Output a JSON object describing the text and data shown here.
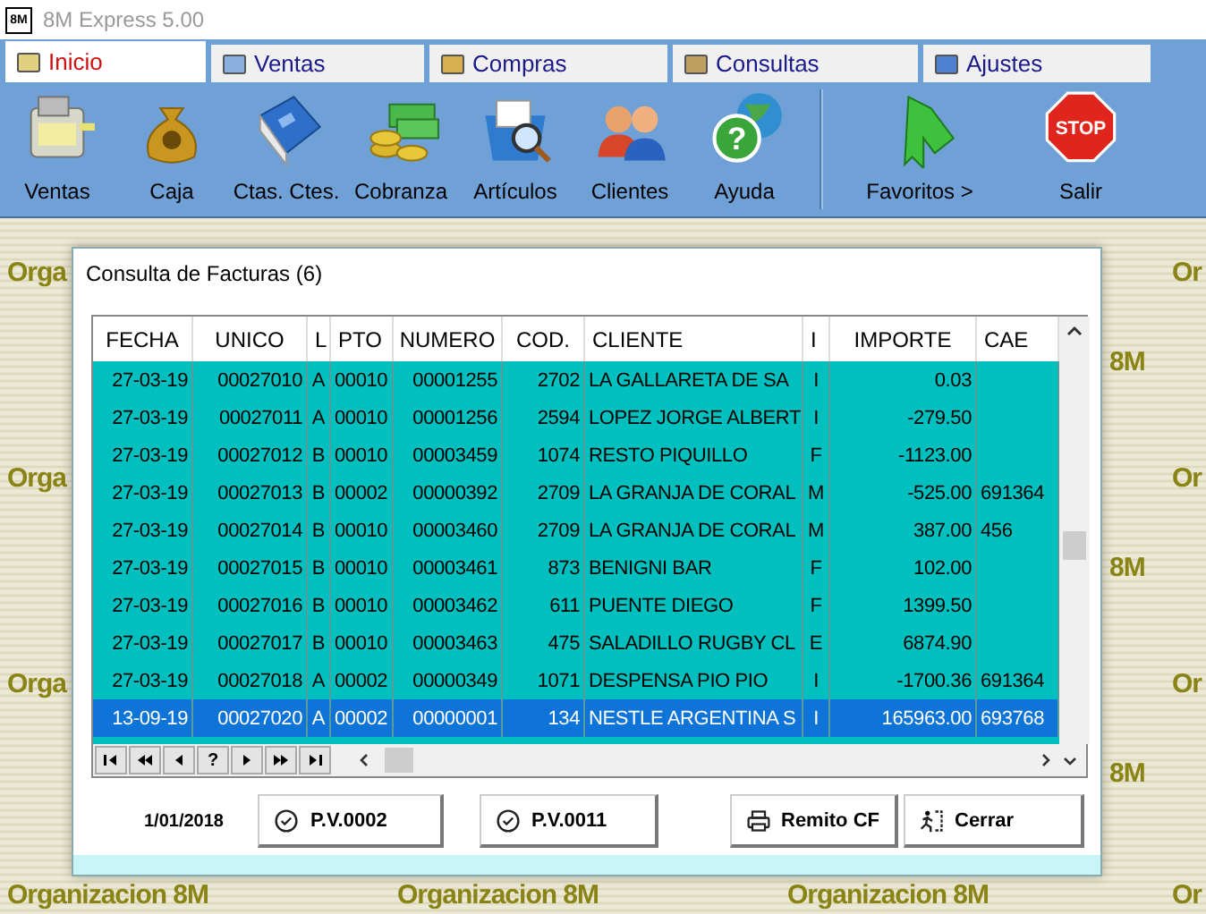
{
  "window": {
    "title": "8M Express 5.00",
    "logo": "8M"
  },
  "tabs": [
    {
      "label": "Inicio",
      "selected": true
    },
    {
      "label": "Ventas",
      "selected": false
    },
    {
      "label": "Compras",
      "selected": false
    },
    {
      "label": "Consultas",
      "selected": false
    },
    {
      "label": "Ajustes",
      "selected": false
    }
  ],
  "toolbar": {
    "groups": [
      [
        {
          "label": "Ventas"
        },
        {
          "label": "Caja"
        },
        {
          "label": "Ctas. Ctes."
        },
        {
          "label": "Cobranza"
        },
        {
          "label": "Artículos"
        },
        {
          "label": "Clientes"
        },
        {
          "label": "Ayuda",
          "icon_text": "?"
        }
      ],
      [
        {
          "label": "Favoritos  >"
        },
        {
          "label": "Salir",
          "icon_text": "STOP"
        }
      ]
    ]
  },
  "wallpaper": [
    "Orga",
    "Orga",
    "Orga",
    "Or",
    "8M",
    "Or",
    "8M",
    "Or",
    "8M",
    "Organizacion 8M",
    "Organizacion 8M",
    "Organizacion 8M",
    "Or"
  ],
  "dialog": {
    "title": "Consulta de Facturas (6)",
    "table": {
      "columns": [
        "FECHA",
        "UNICO",
        "L",
        "PTO",
        "NUMERO",
        "COD.",
        "CLIENTE",
        "I",
        "IMPORTE",
        "CAE"
      ],
      "rows": [
        {
          "cells": [
            "27-03-19",
            "00027010",
            "A",
            "00010",
            "00001255",
            "2702",
            "LA GALLARETA DE SA",
            "I",
            "0.03",
            ""
          ],
          "selected": false
        },
        {
          "cells": [
            "27-03-19",
            "00027011",
            "A",
            "00010",
            "00001256",
            "2594",
            "LOPEZ JORGE ALBERT",
            "I",
            "-279.50",
            ""
          ],
          "selected": false
        },
        {
          "cells": [
            "27-03-19",
            "00027012",
            "B",
            "00010",
            "00003459",
            "1074",
            "RESTO PIQUILLO",
            "F",
            "-1123.00",
            ""
          ],
          "selected": false
        },
        {
          "cells": [
            "27-03-19",
            "00027013",
            "B",
            "00002",
            "00000392",
            "2709",
            "LA GRANJA DE CORAL",
            "M",
            "-525.00",
            "691364"
          ],
          "selected": false
        },
        {
          "cells": [
            "27-03-19",
            "00027014",
            "B",
            "00010",
            "00003460",
            "2709",
            "LA GRANJA DE CORAL",
            "M",
            "387.00",
            "456"
          ],
          "selected": false
        },
        {
          "cells": [
            "27-03-19",
            "00027015",
            "B",
            "00010",
            "00003461",
            "873",
            "BENIGNI BAR",
            "F",
            "102.00",
            ""
          ],
          "selected": false
        },
        {
          "cells": [
            "27-03-19",
            "00027016",
            "B",
            "00010",
            "00003462",
            "611",
            "PUENTE DIEGO",
            "F",
            "1399.50",
            ""
          ],
          "selected": false
        },
        {
          "cells": [
            "27-03-19",
            "00027017",
            "B",
            "00010",
            "00003463",
            "475",
            "SALADILLO RUGBY CL",
            "E",
            "6874.90",
            ""
          ],
          "selected": false
        },
        {
          "cells": [
            "27-03-19",
            "00027018",
            "A",
            "00002",
            "00000349",
            "1071",
            "DESPENSA PIO PIO",
            "I",
            "-1700.36",
            "691364"
          ],
          "selected": false
        },
        {
          "cells": [
            "13-09-19",
            "00027020",
            "A",
            "00002",
            "00000001",
            "134",
            "NESTLE ARGENTINA S",
            "I",
            "165963.00",
            "693768"
          ],
          "selected": true
        }
      ]
    },
    "navigator": [
      {
        "kind": "first"
      },
      {
        "kind": "prior_page"
      },
      {
        "kind": "prior"
      },
      {
        "kind": "help",
        "label": "?"
      },
      {
        "kind": "next"
      },
      {
        "kind": "next_page"
      },
      {
        "kind": "last"
      }
    ],
    "date": "1/01/2018",
    "buttons": [
      {
        "label": "P.V.0002",
        "kind": "check"
      },
      {
        "label": "P.V.0011",
        "kind": "check"
      },
      {
        "label": "Remito CF",
        "kind": "print"
      },
      {
        "label": "Cerrar",
        "kind": "exit"
      }
    ]
  }
}
